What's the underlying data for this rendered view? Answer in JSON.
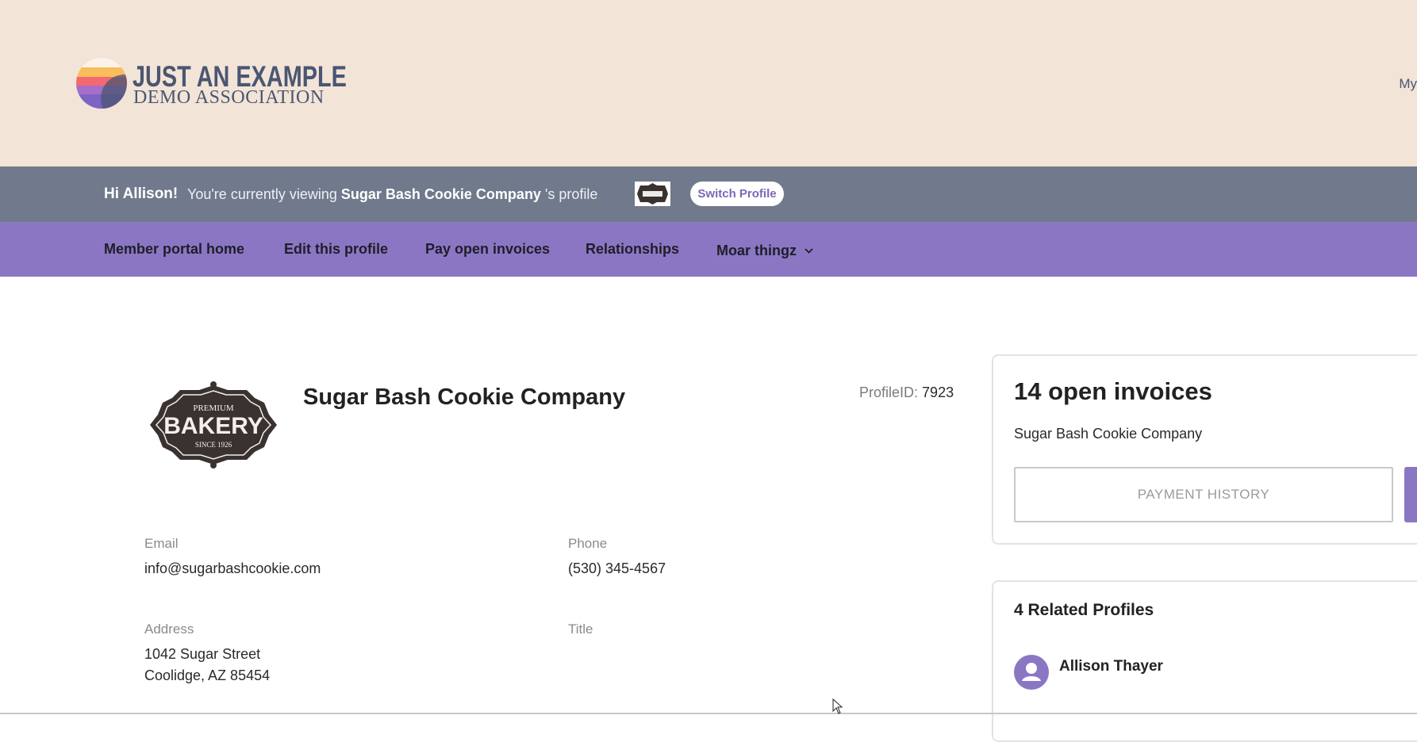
{
  "header": {
    "logo_line1": "JUST AN EXAMPLE",
    "logo_line2": "DEMO ASSOCIATION",
    "my_link": "My"
  },
  "profile_bar": {
    "greeting": "Hi Allison!",
    "viewing_prefix": "You're currently viewing",
    "profile_name": "Sugar Bash Cookie Company",
    "viewing_suffix": "'s profile",
    "switch_label": "Switch Profile"
  },
  "nav": {
    "items": [
      {
        "label": "Member portal home"
      },
      {
        "label": "Edit this profile"
      },
      {
        "label": "Pay open invoices"
      },
      {
        "label": "Relationships"
      },
      {
        "label": "Moar thingz"
      }
    ]
  },
  "profile": {
    "name": "Sugar Bash Cookie Company",
    "logo_text": {
      "top": "PREMIUM",
      "main": "BAKERY",
      "bottom": "SINCE 1926"
    },
    "id_label": "ProfileID:",
    "id_value": "7923",
    "fields": {
      "email_label": "Email",
      "email_value": "info@sugarbashcookie.com",
      "phone_label": "Phone",
      "phone_value": "(530) 345-4567",
      "address_label": "Address",
      "address_line1": "1042 Sugar Street",
      "address_line2": "Coolidge, AZ 85454",
      "title_label": "Title"
    }
  },
  "invoices": {
    "title": "14 open invoices",
    "company": "Sugar Bash Cookie Company",
    "payment_history_label": "PAYMENT HISTORY"
  },
  "related": {
    "title": "4 Related Profiles",
    "items": [
      {
        "name": "Allison Thayer"
      }
    ]
  },
  "colors": {
    "header_bg": "#f2e4d7",
    "profile_bar_bg": "#707a8c",
    "nav_bg": "#8b76c4",
    "accent": "#8b76c4"
  }
}
